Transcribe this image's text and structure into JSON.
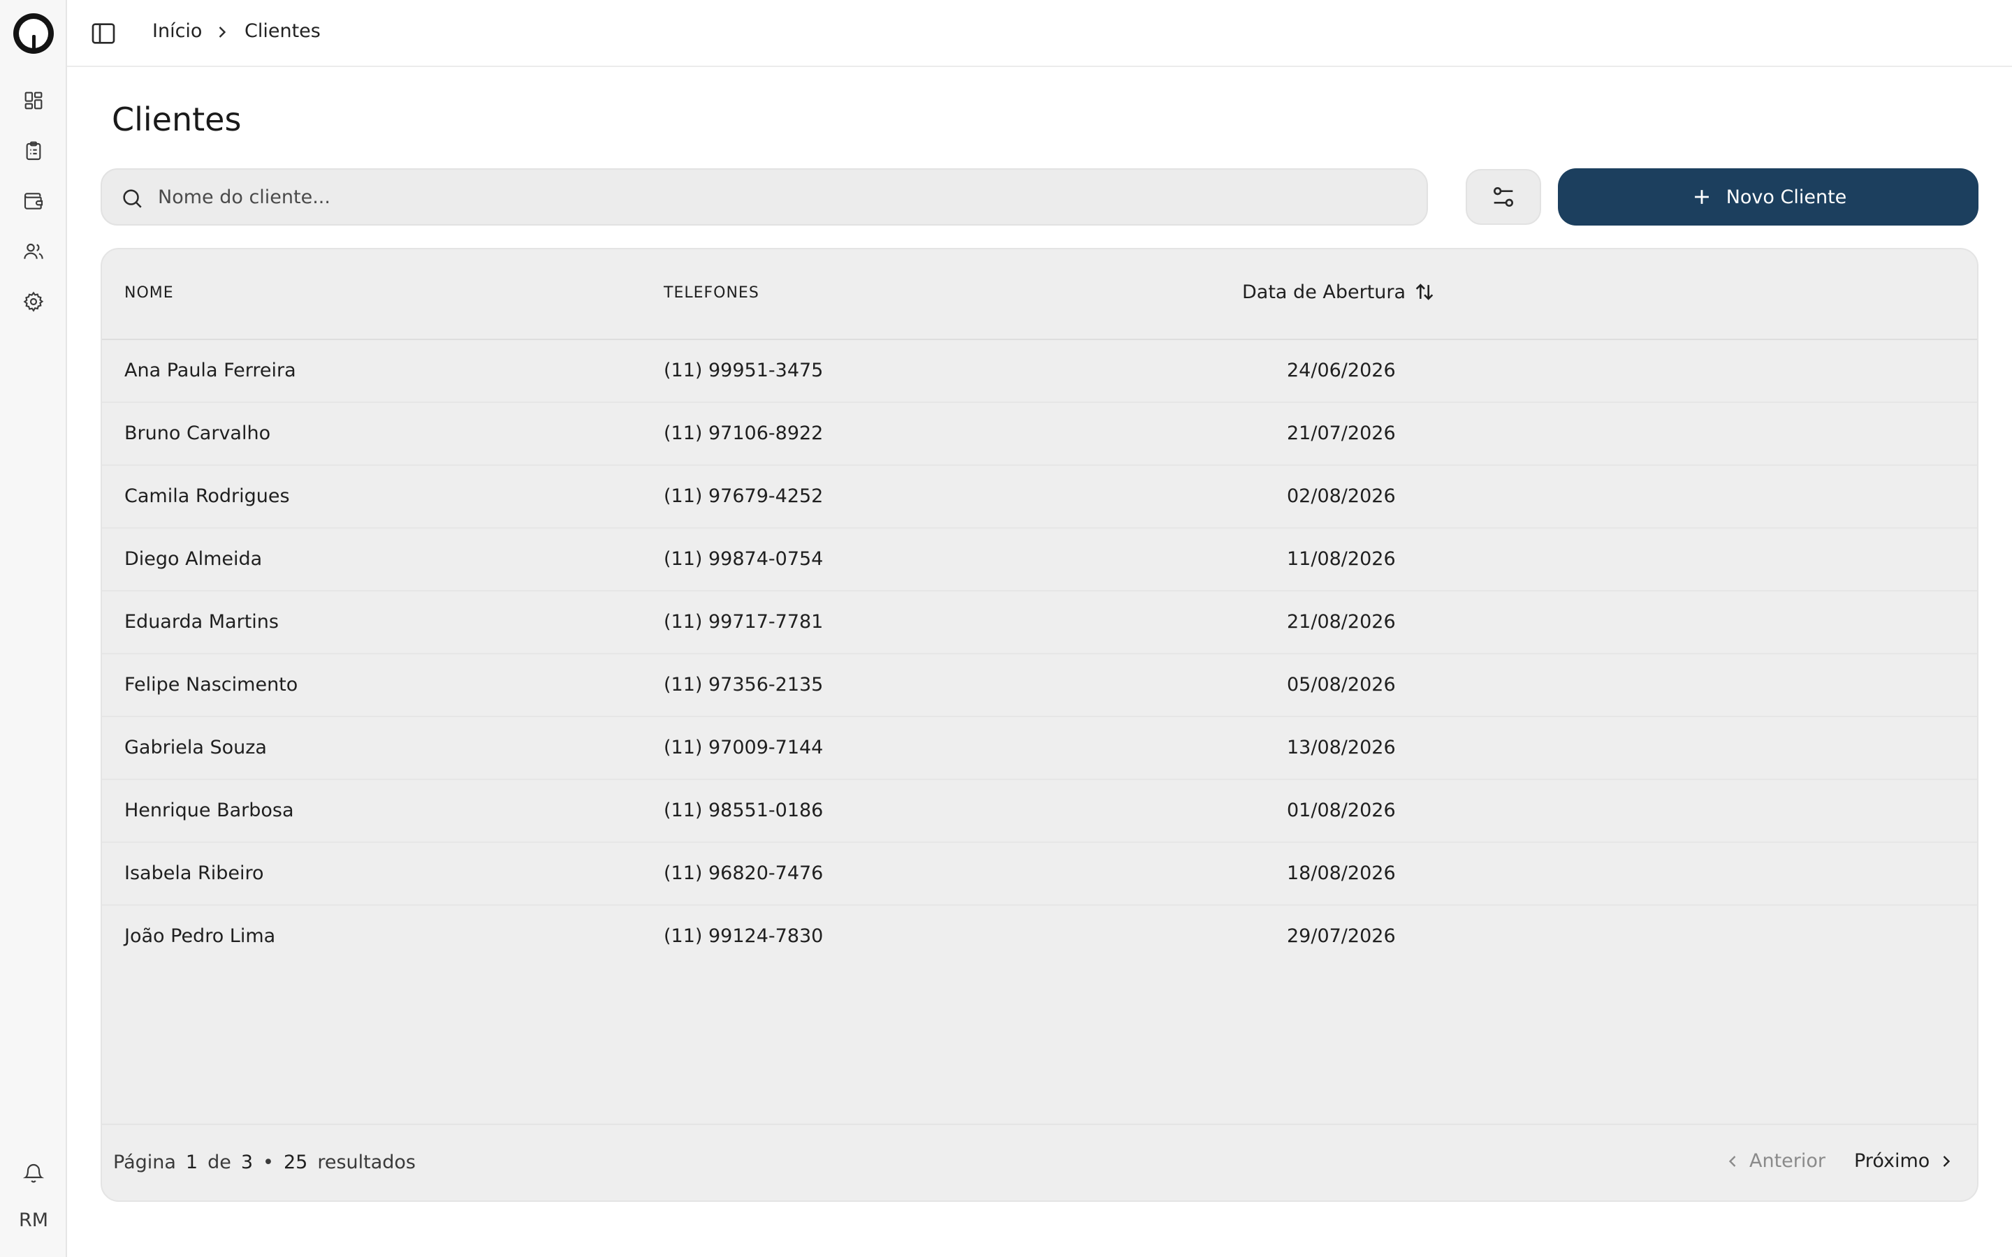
{
  "colors": {
    "primary": "#1c3f5e",
    "surface": "#eeeeee",
    "sidebar": "#f7f7f7"
  },
  "breadcrumb": {
    "home": "Início",
    "current": "Clientes"
  },
  "page": {
    "title": "Clientes"
  },
  "search": {
    "placeholder": "Nome do cliente...",
    "value": ""
  },
  "actions": {
    "new_client": "Novo Cliente"
  },
  "sidebar": {
    "items": [
      {
        "icon": "dashboard-icon"
      },
      {
        "icon": "clipboard-icon"
      },
      {
        "icon": "wallet-icon"
      },
      {
        "icon": "users-icon"
      },
      {
        "icon": "gear-icon"
      }
    ],
    "bell_icon": "bell-icon",
    "avatar": "RM"
  },
  "table": {
    "headers": {
      "name": "NOME",
      "phones": "TELEFONES",
      "opened": "Data de Abertura"
    },
    "rows": [
      {
        "name": "Ana Paula Ferreira",
        "phone": "(11) 99951-3475",
        "date": "24/06/2026"
      },
      {
        "name": "Bruno Carvalho",
        "phone": "(11) 97106-8922",
        "date": "21/07/2026"
      },
      {
        "name": "Camila Rodrigues",
        "phone": "(11) 97679-4252",
        "date": "02/08/2026"
      },
      {
        "name": "Diego Almeida",
        "phone": "(11) 99874-0754",
        "date": "11/08/2026"
      },
      {
        "name": "Eduarda Martins",
        "phone": "(11) 99717-7781",
        "date": "21/08/2026"
      },
      {
        "name": "Felipe Nascimento",
        "phone": "(11) 97356-2135",
        "date": "05/08/2026"
      },
      {
        "name": "Gabriela Souza",
        "phone": "(11) 97009-7144",
        "date": "13/08/2026"
      },
      {
        "name": "Henrique Barbosa",
        "phone": "(11) 98551-0186",
        "date": "01/08/2026"
      },
      {
        "name": "Isabela Ribeiro",
        "phone": "(11) 96820-7476",
        "date": "18/08/2026"
      },
      {
        "name": "João Pedro Lima",
        "phone": "(11) 99124-7830",
        "date": "29/07/2026"
      }
    ]
  },
  "pagination": {
    "page_label": "Página",
    "current_page": "1",
    "of_label": "de",
    "total_pages": "3",
    "separator": "•",
    "results_count": "25",
    "results_label": "resultados",
    "prev": "Anterior",
    "next": "Próximo"
  }
}
